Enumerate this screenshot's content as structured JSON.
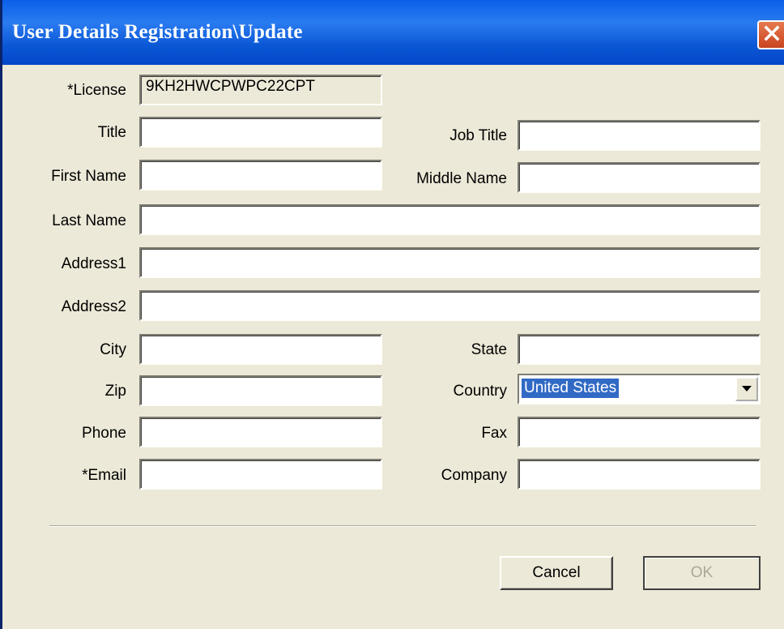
{
  "window": {
    "title": "User Details Registration\\Update"
  },
  "labels": {
    "license": "*License",
    "title": "Title",
    "job_title": "Job Title",
    "first_name": "First Name",
    "middle_name": "Middle Name",
    "last_name": "Last Name",
    "address1": "Address1",
    "address2": "Address2",
    "city": "City",
    "state": "State",
    "zip": "Zip",
    "country": "Country",
    "phone": "Phone",
    "fax": "Fax",
    "email": "*Email",
    "company": "Company"
  },
  "values": {
    "license": "9KH2HWCPWPC22CPT",
    "country": "United States"
  },
  "buttons": {
    "cancel": "Cancel",
    "ok": "OK"
  },
  "icons": {
    "close": "close-icon",
    "dropdown": "chevron-down-icon"
  },
  "colors": {
    "titlebar": "#0a5fe8",
    "dialog_bg": "#ece9d8",
    "selection": "#316ac5",
    "close": "#d9582f"
  }
}
